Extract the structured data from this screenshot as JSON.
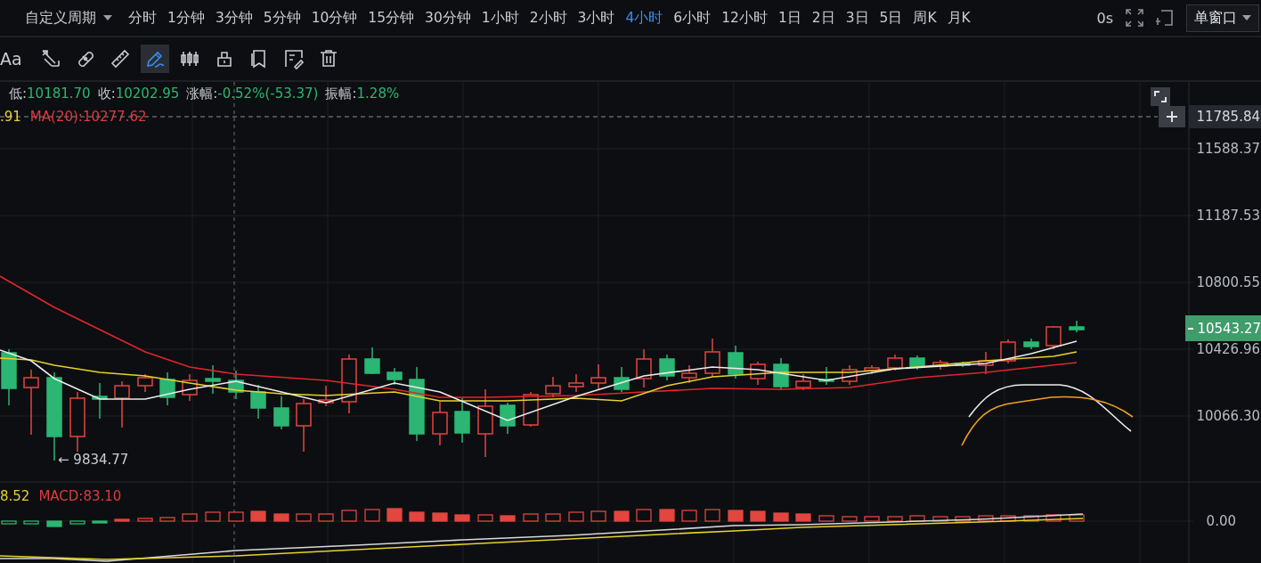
{
  "period_bar": {
    "custom": {
      "label": "自定义周期"
    },
    "periods": [
      {
        "label": "分时",
        "selected": false
      },
      {
        "label": "1分钟",
        "selected": false
      },
      {
        "label": "3分钟",
        "selected": false
      },
      {
        "label": "5分钟",
        "selected": false
      },
      {
        "label": "10分钟",
        "selected": false
      },
      {
        "label": "15分钟",
        "selected": false
      },
      {
        "label": "30分钟",
        "selected": false
      },
      {
        "label": "1小时",
        "selected": false
      },
      {
        "label": "2小时",
        "selected": false
      },
      {
        "label": "3小时",
        "selected": false
      },
      {
        "label": "4小时",
        "selected": true
      },
      {
        "label": "6小时",
        "selected": false
      },
      {
        "label": "12小时",
        "selected": false
      },
      {
        "label": "1日",
        "selected": false
      },
      {
        "label": "2日",
        "selected": false
      },
      {
        "label": "3日",
        "selected": false
      },
      {
        "label": "5日",
        "selected": false
      },
      {
        "label": "周K",
        "selected": false
      },
      {
        "label": "月K",
        "selected": false
      }
    ],
    "refresh": "0s",
    "window_mode": "单窗口"
  },
  "toolbar": {
    "font_button": "Aa",
    "tools": [
      {
        "kind": "ruler-pencil",
        "selected": false
      },
      {
        "kind": "bandage",
        "selected": false
      },
      {
        "kind": "ruler",
        "selected": false
      },
      {
        "kind": "pen",
        "selected": true
      },
      {
        "kind": "bars",
        "selected": false
      },
      {
        "kind": "lock",
        "selected": false
      },
      {
        "kind": "copy",
        "selected": false
      },
      {
        "kind": "edit",
        "selected": false
      },
      {
        "kind": "trash",
        "selected": false
      }
    ]
  },
  "chart": {
    "ohlc": [
      {
        "label": "低:",
        "value": "10181.70"
      },
      {
        "label": "收:",
        "value": "10202.95"
      },
      {
        "label": "涨幅:",
        "value": "-0.52%(-53.37)"
      },
      {
        "label": "振幅:",
        "value": "1.28%"
      }
    ],
    "ma_legend": [
      {
        "text": ".91",
        "color": "#e6d12d"
      },
      {
        "text": "MA(20):10277.62",
        "color": "#e0393e"
      }
    ],
    "crosshair_price": "11785.84",
    "price_axis": [
      "11588.37",
      "11187.53",
      "10800.55",
      "10426.96",
      "10066.30"
    ],
    "last_price": "10543.27",
    "low_marker": "← 9834.77"
  },
  "macd": {
    "legend": [
      {
        "text": "8.52",
        "color": "#e6d12d"
      },
      {
        "text": "MACD:83.10",
        "color": "#e0393e"
      }
    ],
    "axis": [
      "0.00"
    ]
  }
}
